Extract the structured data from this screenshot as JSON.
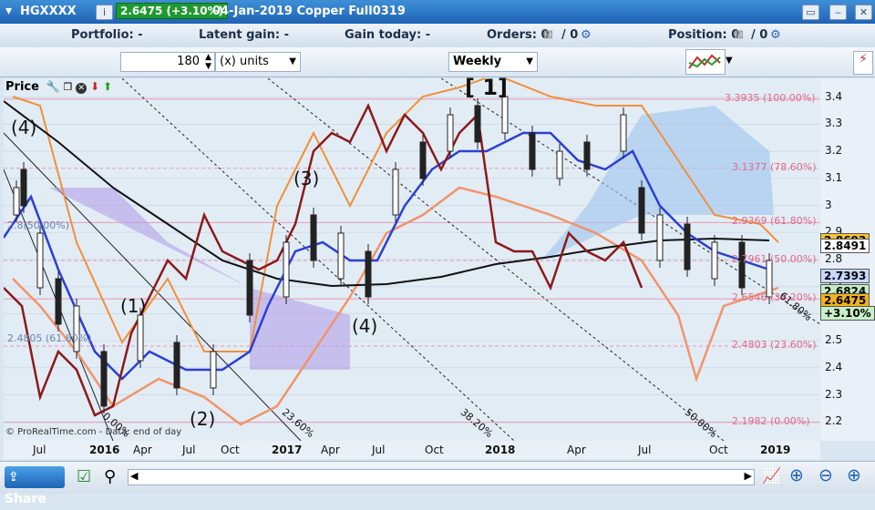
{
  "titlebar": {
    "symbol": "HGXXXX",
    "info_icon": "i",
    "price_change": "2.6475 (+3.10%)",
    "description": "04-Jan-2019 Copper Full0319",
    "buttons": [
      "restore-icon",
      "minimize-icon",
      "close-icon"
    ]
  },
  "infobar": {
    "portfolio": "Portfolio: -",
    "latent_gain": "Latent gain: -",
    "gain_today": "Gain today: -",
    "orders_label": "Orders: 0",
    "orders_sep": "/ 0",
    "position_label": "Position: 0",
    "position_sep": "/ 0"
  },
  "toolbar": {
    "units_value": "180",
    "units_label": "(x) units",
    "timeframe": "Weekly"
  },
  "price_panel": {
    "label": "Price"
  },
  "chart_data": {
    "type": "line",
    "y_ticks": [
      "3.4",
      "3.3",
      "3.2",
      "3.1",
      "3",
      "2.9",
      "2.8",
      "2.7",
      "2.6",
      "2.5",
      "2.4",
      "2.3",
      "2.2"
    ],
    "x_ticks": [
      "Jul",
      "2016",
      "Apr",
      "Jul",
      "Oct",
      "2017",
      "Apr",
      "Jul",
      "Oct",
      "2018",
      "Apr",
      "Jul",
      "Oct",
      "2019"
    ],
    "fib_levels": [
      {
        "text": "3.3935 (100.00%)",
        "value": 3.3935
      },
      {
        "text": "3.1377 (78.60%)",
        "value": 3.1377
      },
      {
        "text": "2.9369 (61.80%)",
        "value": 2.9369
      },
      {
        "text": "2.7961 (50.00%)",
        "value": 2.7961
      },
      {
        "text": "2.6546 (38.20%)",
        "value": 2.6546
      },
      {
        "text": "2.4803 (23.60%)",
        "value": 2.4803
      },
      {
        "text": "2.1982 (0.00%)",
        "value": 2.1982
      }
    ],
    "fib_left": [
      {
        "text": "2.8(50.00%)",
        "value": 2.92
      },
      {
        "text": "2.4805 (61.80%)",
        "value": 2.505
      }
    ],
    "fan_labels": [
      "23.60%",
      "38.20%",
      "50.00%",
      "61.80%",
      "0.00%"
    ],
    "wave_labels": [
      "(4)",
      "(1)",
      "(2)",
      "(3)",
      "(4)",
      "[ 1]"
    ],
    "price_tags": [
      {
        "text": "2.8693",
        "value": 2.8693,
        "bg": "#f4c430"
      },
      {
        "text": "2.8491",
        "value": 2.8491,
        "bg": "#ffffff"
      },
      {
        "text": "2.7393",
        "value": 2.7393,
        "bg": "#c8d8ff"
      },
      {
        "text": "2.6824",
        "value": 2.6824,
        "bg": "#c4ecc4"
      },
      {
        "text": "2.6475",
        "value": 2.6475,
        "bg": "#f2b221"
      },
      {
        "text": "+3.10%",
        "value": 2.6,
        "bg": "#c7f0c7"
      }
    ],
    "ylim": [
      2.13,
      3.47
    ],
    "copyright": "© ProRealTime.com - Data: end of day"
  },
  "statusbar": {
    "share_label": "Share"
  },
  "colors": {
    "accent": "#1f63b5",
    "price_up": "#1f9a31"
  }
}
